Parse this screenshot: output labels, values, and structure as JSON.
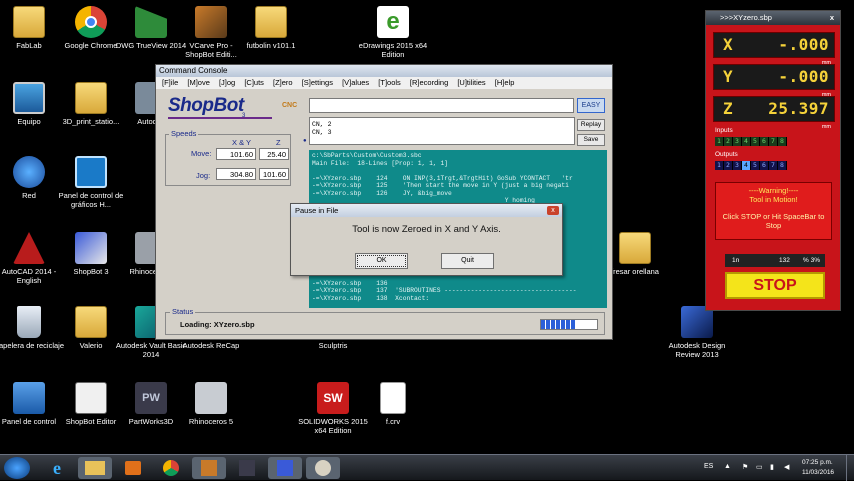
{
  "desktop": {
    "icons": [
      {
        "label": "FabLab"
      },
      {
        "label": "Google Chrome"
      },
      {
        "label": "DWG TrueView 2014"
      },
      {
        "label": "VCarve Pro - ShopBot Editi..."
      },
      {
        "label": "futbolin v101.1"
      },
      {
        "label": "eDrawings 2015 x64 Edition"
      },
      {
        "label": "Equipo"
      },
      {
        "label": "3D_print_statio..."
      },
      {
        "label": "Autodes"
      },
      {
        "label": "Red"
      },
      {
        "label": "Panel de control de gráficos H..."
      },
      {
        "label": "AutoCAD 2014 - English"
      },
      {
        "label": "ShopBot 3"
      },
      {
        "label": "Rhinoce (64-"
      },
      {
        "label": "fresar orellana"
      },
      {
        "label": "Papelera de reciclaje"
      },
      {
        "label": "Valerio"
      },
      {
        "label": "Autodesk Vault Basic 2014"
      },
      {
        "label": "Autodesk ReCap"
      },
      {
        "label": "Sculptris"
      },
      {
        "label": "Autodesk Design Review 2013"
      },
      {
        "label": "Panel de control"
      },
      {
        "label": "ShopBot Editor"
      },
      {
        "label": "PartWorks3D"
      },
      {
        "label": "Rhinoceros 5"
      },
      {
        "label": "SOLIDWORKS 2015 x64 Edition"
      },
      {
        "label": "f.crv"
      }
    ]
  },
  "console": {
    "title": "Command Console",
    "menu": [
      "[F]ile",
      "[M]ove",
      "[J]og",
      "[C]uts",
      "[Z]ero",
      "[S]ettings",
      "[V]alues",
      "[T]ools",
      "[R]ecording",
      "[U]tilities",
      "[H]elp"
    ],
    "logo": "ShopBot",
    "logo_sub": "CNC",
    "logo_tag": "3",
    "speeds": {
      "group_label": "Speeds",
      "col_xy": "X & Y",
      "col_z": "Z",
      "move_label": "Move:",
      "jog_label": "Jog:",
      "move_xy": "101.60",
      "move_z": "25.40",
      "jog_xy": "304.80",
      "jog_z": "101.60"
    },
    "command_value": "",
    "easy_label": "EASY",
    "history": [
      "CN, 2",
      "CN, 3"
    ],
    "replay_label": "Replay",
    "save_label": "Save",
    "file_lines": [
      "c:\\SbParts\\Custom\\Custom3.sbc",
      "Main File:  18-Lines [Prop: 1, 1, 1]",
      "",
      "-=\\XYzero.sbp    124    ON INP(3,1Trgt,&TrgtHit) GoSub YCONTACT   'tr",
      "-=\\XYzero.sbp    125    'Then start the move in Y (just a big negati",
      "-=\\XYzero.sbp    126    JY, &big_move",
      "                                                   Y homing",
      "                                                   Y)jog_Spee",
      "",
      "",
      "",
      "",
      "",
      "",
      "                                                   the progra",
      "                                                   routines",
      "",
      "-=\\XYzero.sbp    136",
      "-=\\XYzero.sbp    137  'SUBROUTINES -----------------------------------",
      "-=\\XYzero.sbp    138  Xcontact:"
    ],
    "status": {
      "group_label": "Status",
      "message": "Loading: XYzero.sbp",
      "progress": 0.62
    }
  },
  "pause_dialog": {
    "title": "Pause in File",
    "message": "Tool is now Zeroed in X and Y Axis.",
    "ok_label": "OK",
    "quit_label": "Quit",
    "close_glyph": "x"
  },
  "dro": {
    "title": ">>>XYzero.sbp",
    "close_glyph": "x",
    "axes": [
      {
        "name": "X",
        "value": "-.000",
        "unit": "mm"
      },
      {
        "name": "Y",
        "value": "-.000",
        "unit": "mm"
      },
      {
        "name": "Z",
        "value": "25.397",
        "unit": "mm"
      }
    ],
    "inputs_label": "Inputs",
    "inputs": [
      "1",
      "2",
      "3",
      "4",
      "5",
      "6",
      "7",
      "8"
    ],
    "outputs_label": "Outputs",
    "outputs": [
      "1",
      "2",
      "3",
      "4",
      "5",
      "6",
      "7",
      "8"
    ],
    "outputs_active": [
      4
    ],
    "warning_title": "----Warning!----",
    "warning_line1": "Tool in Motion!",
    "warning_line2": "Click STOP or Hit SpaceBar to Stop",
    "speed_unit": "1n",
    "speed_value": "132",
    "speed_pct": "% 3%",
    "stop_label": "STOP"
  },
  "taskbar": {
    "language": "ES",
    "time": "07:25 p.m.",
    "date": "11/03/2016"
  },
  "colors": {
    "accent_blue": "#1a2a8a",
    "file_bg": "#0f8a8a",
    "dro_red": "#c8141a",
    "stop_yellow": "#f4e41a"
  }
}
